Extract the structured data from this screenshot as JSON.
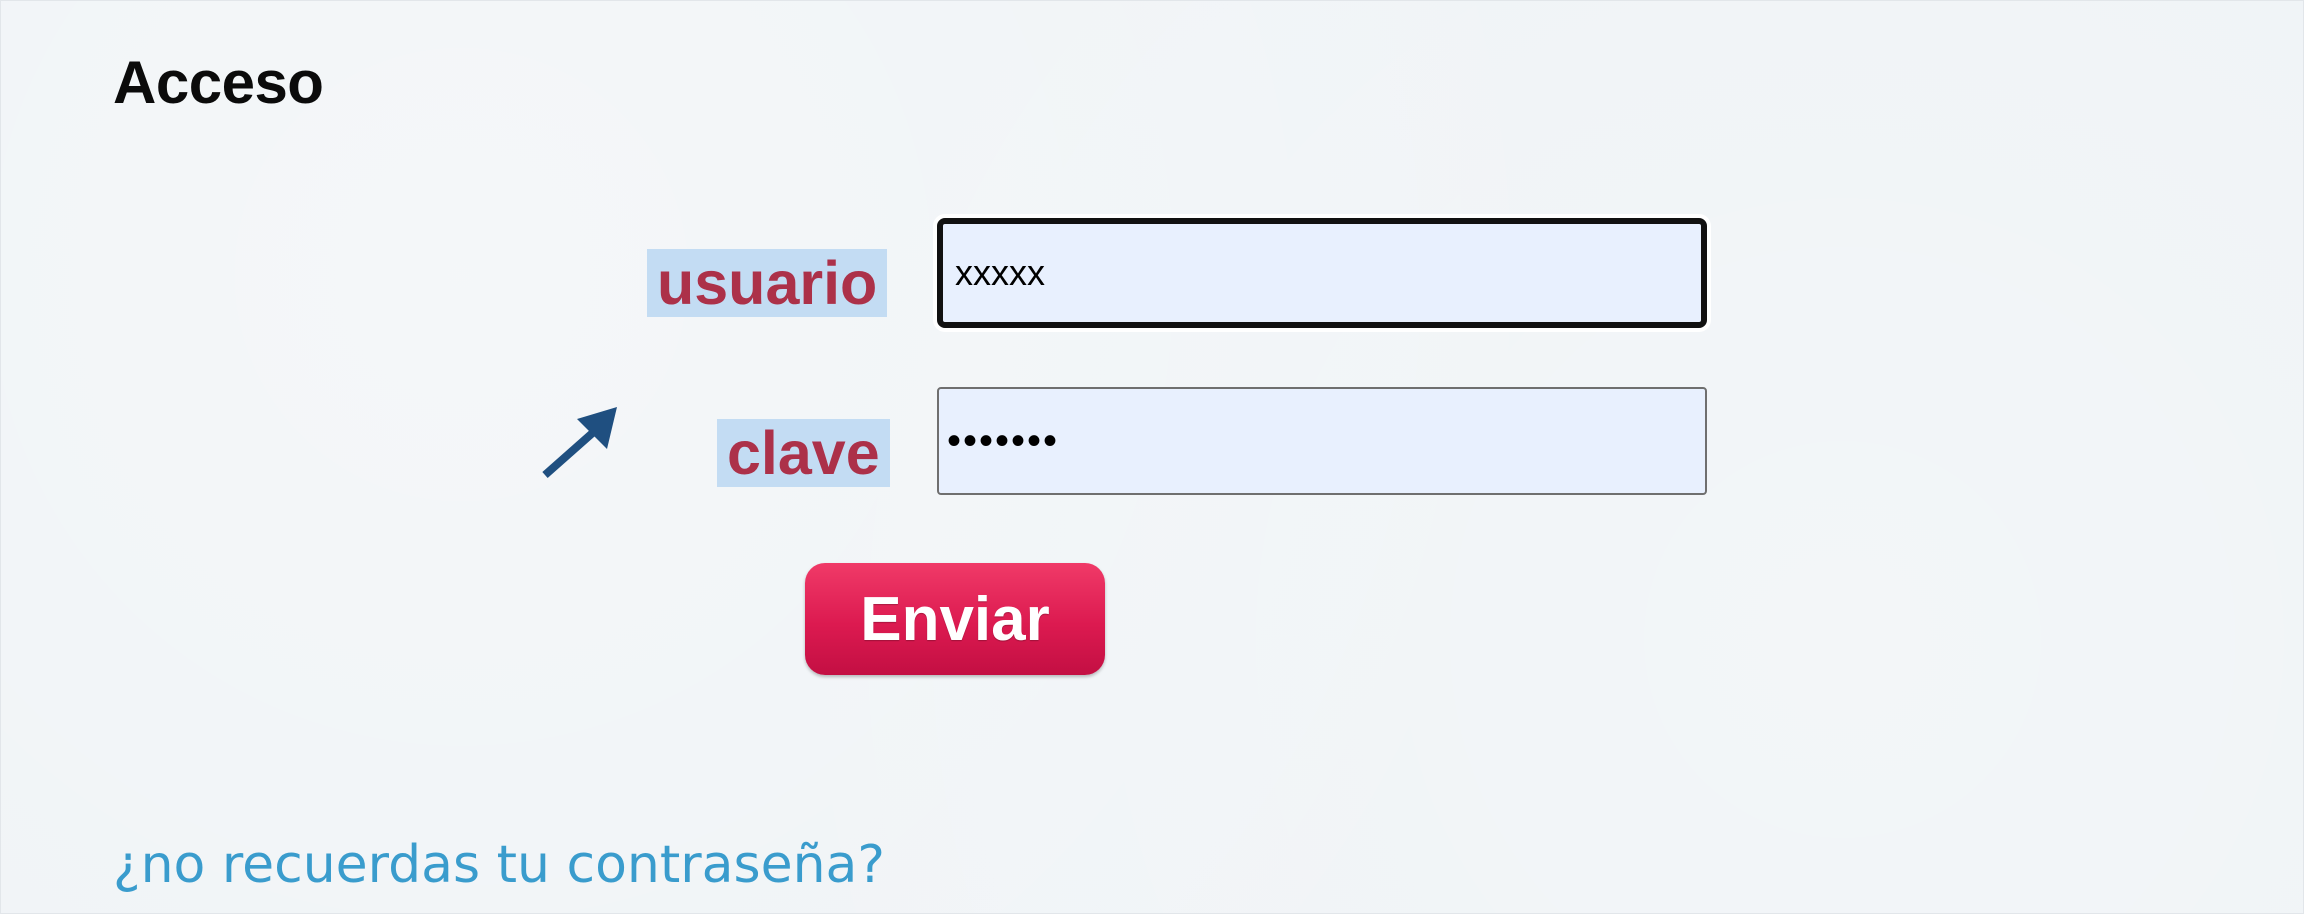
{
  "page": {
    "title": "Acceso"
  },
  "form": {
    "username_label": "usuario",
    "username_value": "xxxxx",
    "password_label": "clave",
    "password_value": "•••••••",
    "submit_label": "Enviar"
  },
  "links": {
    "forgot_password": "¿no recuerdas tu contraseña?"
  },
  "icons": {
    "pointer": "arrow-up-right-icon"
  },
  "colors": {
    "label_text": "#ac3149",
    "label_highlight": "#c3dcf3",
    "input_background": "#e8f0fe",
    "button": "#dc1a50",
    "link": "#3a9ccd",
    "arrow": "#1f4f80"
  }
}
